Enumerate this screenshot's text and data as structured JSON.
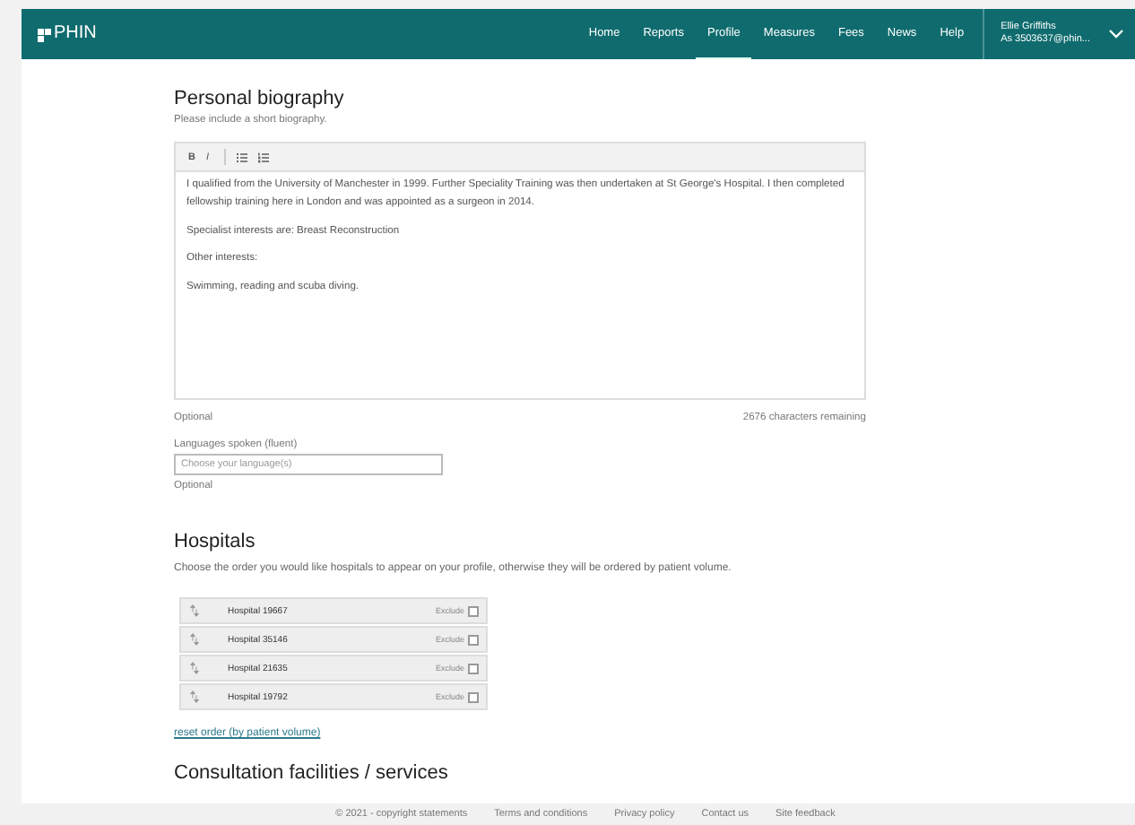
{
  "header": {
    "logo": "PHIN",
    "nav": [
      {
        "label": "Home",
        "selected": false
      },
      {
        "label": "Reports",
        "selected": false
      },
      {
        "label": "Profile",
        "selected": true
      },
      {
        "label": "Measures",
        "selected": false
      },
      {
        "label": "Fees",
        "selected": false
      },
      {
        "label": "News",
        "selected": false
      },
      {
        "label": "Help",
        "selected": false
      }
    ],
    "user": {
      "name": "Ellie Griffiths",
      "account": "As 3503637@phin..."
    }
  },
  "biography": {
    "title": "Personal biography",
    "hint": "Please include a short biography.",
    "toolbar": [
      "B",
      "I"
    ],
    "paragraphs": [
      "I qualified from the University of Manchester in 1999. Further Speciality Training was then undertaken at St George's Hospital. I then completed fellowship training here in London and was appointed as a surgeon in 2014.",
      "Specialist interests are: Breast Reconstruction",
      "Other interests:",
      "Swimming, reading and scuba diving."
    ],
    "optional": "Optional",
    "remaining": "2676 characters remaining"
  },
  "languages": {
    "label": "Languages spoken (fluent)",
    "placeholder": "Choose your language(s)",
    "optional": "Optional"
  },
  "hospitals": {
    "title": "Hospitals",
    "description": "Choose the order you would like hospitals to appear on your profile, otherwise they will be ordered by patient volume.",
    "rows": [
      {
        "name": "Hospital 19667",
        "exclude_label": "Exclude",
        "excluded": false
      },
      {
        "name": "Hospital 35146",
        "exclude_label": "Exclude",
        "excluded": false
      },
      {
        "name": "Hospital 21635",
        "exclude_label": "Exclude",
        "excluded": false
      },
      {
        "name": "Hospital 19792",
        "exclude_label": "Exclude",
        "excluded": false
      }
    ],
    "reset_link": "reset order (by patient volume)"
  },
  "consultation": {
    "title": "Consultation facilities / services"
  },
  "footer": {
    "links": [
      "© 2021 - copyright statements",
      "Terms and conditions",
      "Privacy policy",
      "Contact us",
      "Site feedback"
    ]
  }
}
